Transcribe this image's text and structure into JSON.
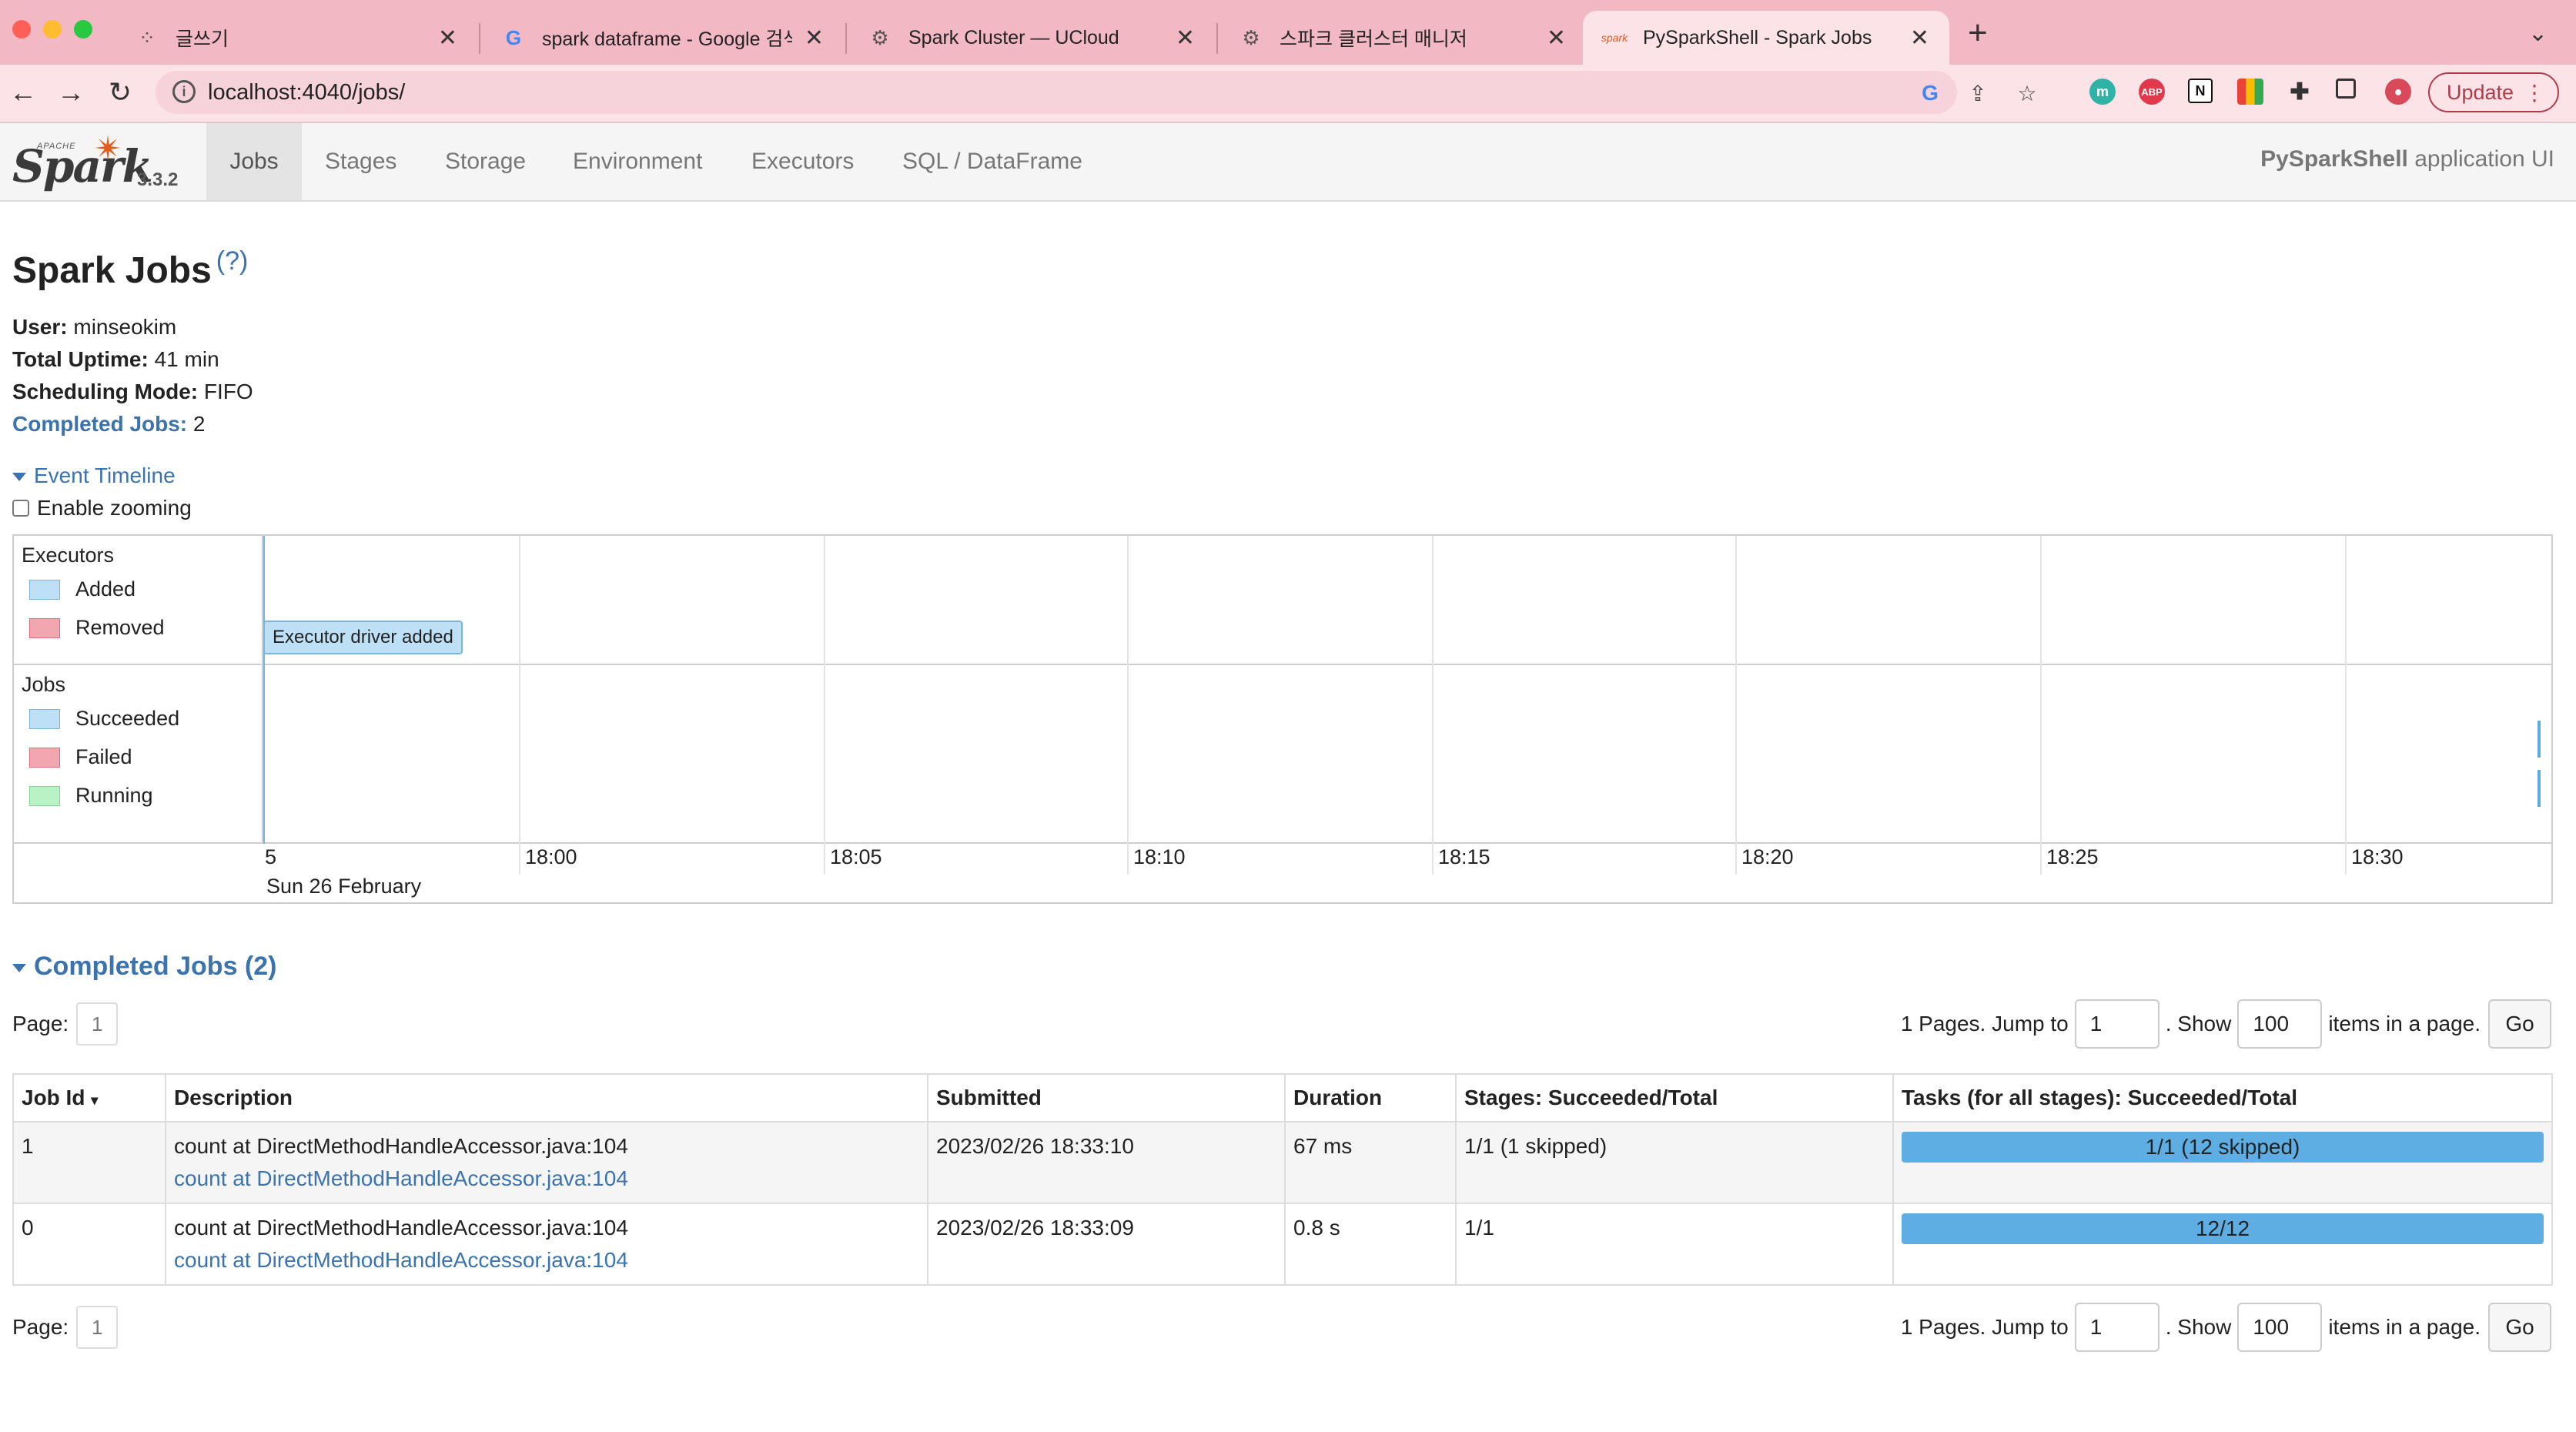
{
  "browser": {
    "tabs": [
      {
        "title": "글쓰기"
      },
      {
        "title": "spark dataframe - Google 검색"
      },
      {
        "title": "Spark Cluster — UCloud"
      },
      {
        "title": "스파크 클러스터 매니저"
      },
      {
        "title": "PySparkShell - Spark Jobs"
      }
    ],
    "url": "localhost:4040/jobs/",
    "update_label": "Update"
  },
  "spark_nav": {
    "version": "3.3.2",
    "links": [
      "Jobs",
      "Stages",
      "Storage",
      "Environment",
      "Executors",
      "SQL / DataFrame"
    ],
    "app_name": "PySparkShell",
    "app_suffix": "application UI"
  },
  "page": {
    "title": "Spark Jobs",
    "help": "(?)",
    "user_label": "User:",
    "user": "minseokim",
    "uptime_label": "Total Uptime:",
    "uptime": "41 min",
    "mode_label": "Scheduling Mode:",
    "mode": "FIFO",
    "completed_label": "Completed Jobs:",
    "completed_count": "2"
  },
  "timeline": {
    "toggle_label": "Event Timeline",
    "zoom_label": "Enable zooming",
    "executors_title": "Executors",
    "executors_legend": [
      "Added",
      "Removed"
    ],
    "jobs_title": "Jobs",
    "jobs_legend": [
      "Succeeded",
      "Failed",
      "Running"
    ],
    "executor_event": "Executor driver added",
    "axis_labels": [
      "5",
      "18:00",
      "18:05",
      "18:10",
      "18:15",
      "18:20",
      "18:25",
      "18:30"
    ],
    "date_label": "Sun 26 February"
  },
  "completed": {
    "title": "Completed Jobs (2)",
    "page_label": "Page:",
    "page_value": "1",
    "pages_text": "1 Pages. Jump to",
    "jump_value": "1",
    "show_label": ". Show",
    "show_value": "100",
    "items_label": "items in a page.",
    "go_label": "Go",
    "columns": [
      "Job Id",
      "Description",
      "Submitted",
      "Duration",
      "Stages: Succeeded/Total",
      "Tasks (for all stages): Succeeded/Total"
    ],
    "sort_indicator": "▾",
    "rows": [
      {
        "id": "1",
        "desc": "count at DirectMethodHandleAccessor.java:104",
        "desc_link": "count at DirectMethodHandleAccessor.java:104",
        "submitted": "2023/02/26 18:33:10",
        "duration": "67 ms",
        "stages": "1/1 (1 skipped)",
        "tasks": "1/1 (12 skipped)",
        "tasks_progress": 1.0
      },
      {
        "id": "0",
        "desc": "count at DirectMethodHandleAccessor.java:104",
        "desc_link": "count at DirectMethodHandleAccessor.java:104",
        "submitted": "2023/02/26 18:33:09",
        "duration": "0.8 s",
        "stages": "1/1",
        "tasks": "12/12",
        "tasks_progress": 1.0
      }
    ]
  },
  "colors": {
    "link": "#3b73af",
    "legend_added": "#bde0f6",
    "legend_removed": "#f2a6b0",
    "legend_running": "#b9f2c4",
    "progress": "#5faee3"
  }
}
